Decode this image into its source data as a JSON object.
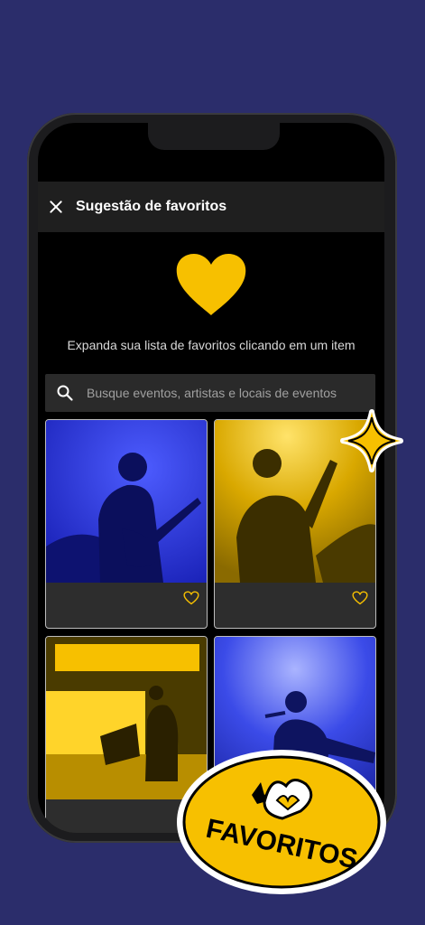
{
  "header": {
    "title": "Sugestão de favoritos"
  },
  "intro": {
    "text": "Expanda sua lista de favoritos clicando em um item"
  },
  "search": {
    "placeholder": "Busque eventos, artistas e locais de eventos"
  },
  "cards": [
    {
      "label": "guitarist-blue"
    },
    {
      "label": "guitarist-yellow"
    },
    {
      "label": "dj-yellow"
    },
    {
      "label": "singer-blue"
    }
  ],
  "sticker": {
    "text": "FAVORITOS"
  },
  "colors": {
    "accent": "#f7c000",
    "background": "#2b2d6b",
    "blue": "#2a3ad8"
  }
}
